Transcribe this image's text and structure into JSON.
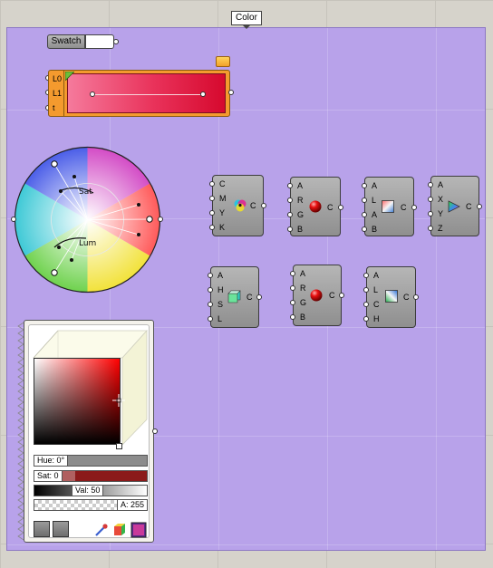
{
  "group": {
    "title": "Color",
    "fill_color": "#b8a2ea"
  },
  "swatch": {
    "label": "Swatch",
    "swatch_color": "#ffffff"
  },
  "gradient": {
    "inputs": [
      "L0",
      "L1",
      "t"
    ],
    "stops": [
      "#f57a9c",
      "#e9325a",
      "#d6092e"
    ],
    "body_color": "#f49a2e"
  },
  "wheel": {
    "sat_label": "Sat",
    "lum_label": "Lum"
  },
  "components": {
    "cmyk": {
      "inputs": [
        "C",
        "M",
        "Y",
        "K"
      ],
      "output": "C",
      "icon": "cmyk-icon"
    },
    "argb": {
      "inputs": [
        "A",
        "R",
        "G",
        "B"
      ],
      "output": "C",
      "icon": "red-sphere-icon"
    },
    "lab": {
      "inputs": [
        "A",
        "L",
        "A",
        "B"
      ],
      "output": "C",
      "icon": "lab-square-icon"
    },
    "xyz": {
      "inputs": [
        "A",
        "X",
        "Y",
        "Z"
      ],
      "output": "C",
      "icon": "xyz-triangle-icon"
    },
    "hsl": {
      "inputs": [
        "A",
        "H",
        "S",
        "L"
      ],
      "output": "C",
      "icon": "hsl-cube-icon"
    },
    "rgb": {
      "inputs": [
        "A",
        "R",
        "G",
        "B"
      ],
      "output": "C",
      "icon": "red-sphere-icon"
    },
    "lch": {
      "inputs": [
        "A",
        "L",
        "C",
        "H"
      ],
      "output": "C",
      "icon": "lch-square-icon"
    }
  },
  "picker": {
    "hue_label": "Hue: 0°",
    "sat_label": "Sat: 0",
    "val_label": "Val: 50",
    "alpha_label": "A: 255",
    "hue_value": 0,
    "sat_value": 0,
    "val_value": 50,
    "alpha_value": 255
  }
}
